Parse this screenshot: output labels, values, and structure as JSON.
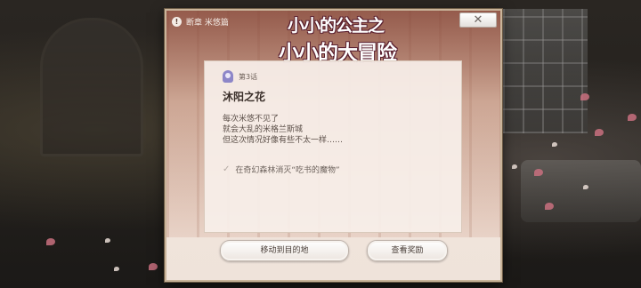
{
  "header": {
    "chapter_tag": "断章 米悠篇",
    "logo_line1": "小小的公主之",
    "logo_line2": "小小的大冒险",
    "close_symbol": "✕"
  },
  "episode": {
    "number_label": "第3话",
    "title": "沐阳之花",
    "description_lines": [
      "每次米悠不见了",
      "就会大乱的米格兰斯城",
      "但这次情况好像有些不太一样……"
    ],
    "task": "在奇幻森林消灭“吃书的魔物”"
  },
  "buttons": {
    "move": "移动到目的地",
    "reward": "查看奖励"
  },
  "icons": {
    "chapter": "info-icon",
    "episode": "episode-badge-icon",
    "task": "check-icon",
    "close": "close-icon"
  },
  "colors": {
    "accent_purple": "#8d86c8",
    "dialog_bg": "#f3e8e1",
    "petal": "#c9707f"
  }
}
